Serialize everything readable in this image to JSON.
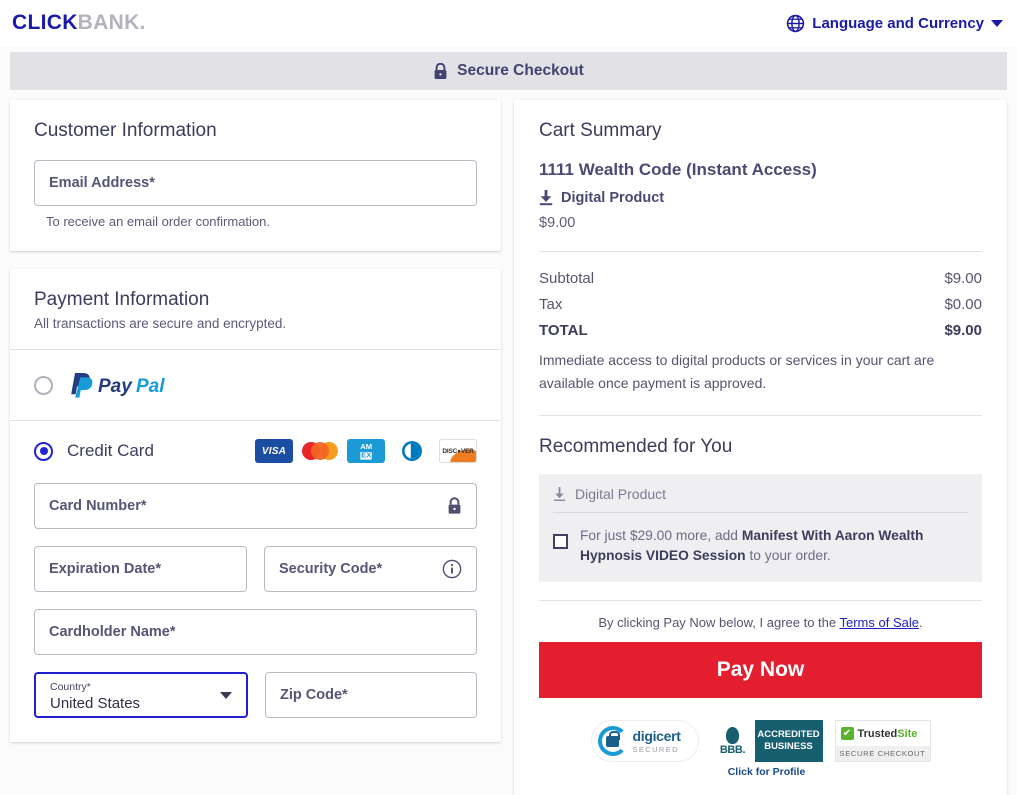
{
  "header": {
    "logo_primary": "CLICK",
    "logo_secondary": "BANK.",
    "language_label": "Language and Currency",
    "globe_icon": "globe-icon",
    "caret_icon": "chevron-down-icon"
  },
  "secure_bar": {
    "label": "Secure Checkout",
    "icon": "lock-icon"
  },
  "customer": {
    "title": "Customer Information",
    "email_placeholder": "Email Address*",
    "email_value": "",
    "helper": "To receive an email order confirmation."
  },
  "payment": {
    "title": "Payment Information",
    "subtitle": "All transactions are secure and encrypted.",
    "paypal_label": "PayPal",
    "paypal_selected": false,
    "credit_card_label": "Credit Card",
    "credit_card_selected": true,
    "brands": [
      "VISA",
      "mastercard",
      "AMEX",
      "diners-club",
      "DISCOVER"
    ],
    "fields": {
      "card_number_placeholder": "Card Number*",
      "card_number_value": "",
      "card_number_icon": "lock-icon",
      "expiration_placeholder": "Expiration Date*",
      "expiration_value": "",
      "security_code_placeholder": "Security Code*",
      "security_code_value": "",
      "security_code_icon": "info-icon",
      "cardholder_placeholder": "Cardholder Name*",
      "cardholder_value": "",
      "country_label": "Country*",
      "country_value": "United States",
      "country_icon": "chevron-down-icon",
      "zip_placeholder": "Zip Code*",
      "zip_value": ""
    }
  },
  "cart": {
    "title": "Cart Summary",
    "product_name": "1111 Wealth Code (Instant Access)",
    "product_type": "Digital Product",
    "product_type_icon": "download-icon",
    "product_price": "$9.00",
    "lines": [
      {
        "label": "Subtotal",
        "value": "$9.00",
        "bold": false
      },
      {
        "label": "Tax",
        "value": "$0.00",
        "bold": false
      },
      {
        "label": "TOTAL",
        "value": "$9.00",
        "bold": true
      }
    ],
    "note": "Immediate access to digital products or services in your cart are available once payment is approved."
  },
  "recommended": {
    "title": "Recommended for You",
    "item_type": "Digital Product",
    "item_type_icon": "download-icon",
    "checked": false,
    "offer_prefix": "For just $29.00 more, add ",
    "offer_product": "Manifest With Aaron Wealth Hypnosis VIDEO Session",
    "offer_suffix": " to your order."
  },
  "footer": {
    "agree_prefix": "By clicking Pay Now below, I agree to the ",
    "agree_link": "Terms of Sale",
    "agree_suffix": ".",
    "pay_button": "Pay Now"
  },
  "badges": {
    "digicert_name": "digicert",
    "digicert_sub": "SECURED",
    "bbb_line1": "ACCREDITED",
    "bbb_line2": "BUSINESS",
    "bbb_mark": "BBB.",
    "bbb_cta": "Click for Profile",
    "trustedsite_name": "Trusted",
    "trustedsite_name2": "Site",
    "trustedsite_sub": "SECURE CHECKOUT"
  },
  "colors": {
    "brand_blue": "#1a1aa8",
    "accent_red": "#e31e2e",
    "text_dark": "#3c3c5c",
    "secure_bar_bg": "#e1e1e6"
  }
}
